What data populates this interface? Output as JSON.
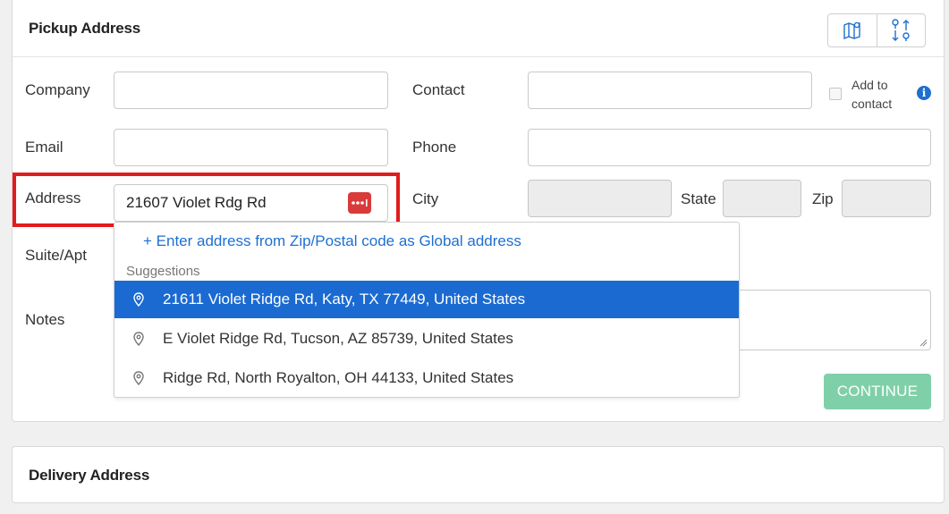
{
  "pickup": {
    "title": "Pickup Address",
    "icons": [
      "map-icon",
      "route-icon"
    ],
    "fields": {
      "company_label": "Company",
      "company_value": "",
      "contact_label": "Contact",
      "contact_value": "",
      "add_to_contact_label": "Add to contact",
      "add_to_contact_checked": false,
      "email_label": "Email",
      "email_value": "",
      "phone_label": "Phone",
      "phone_value": "",
      "address_label": "Address",
      "address_value": "21607 Violet Rdg Rd",
      "city_label": "City",
      "city_value": "",
      "state_label": "State",
      "state_value": "",
      "zip_label": "Zip",
      "zip_value": "",
      "suite_label": "Suite/Apt",
      "notes_label": "Notes"
    },
    "continue_label": "CONTINUE"
  },
  "dropdown": {
    "enter_link": "+ Enter address from Zip/Postal code as Global address",
    "suggestions_header": "Suggestions",
    "suggestions": [
      {
        "text": "21611 Violet Ridge Rd, Katy, TX 77449, United States",
        "active": true
      },
      {
        "text": "E Violet Ridge Rd, Tucson, AZ 85739, United States",
        "active": false
      },
      {
        "text": "Ridge Rd, North Royalton, OH 44133, United States",
        "active": false
      }
    ]
  },
  "delivery": {
    "title": "Delivery Address"
  },
  "colors": {
    "accent_blue": "#1a6ad2",
    "highlight_red": "#e21b1b",
    "continue_green": "#7fd0a8",
    "address_button_red": "#d93a3a"
  }
}
